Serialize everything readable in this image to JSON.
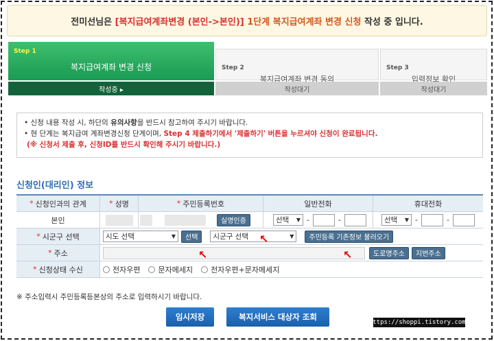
{
  "banner": {
    "name": "전미선님은",
    "highlight": "[복지급여계좌변경 (본인->본인)]",
    "step": "1단계 복지급여계좌 변경 신청",
    "suffix": "작성 중 입니다."
  },
  "steps": [
    {
      "num": "Step 1",
      "title": "복지급여계좌 변경 신청",
      "status": "작성중 ▸"
    },
    {
      "num": "Step 2",
      "title": "복지급여계좌 변경 동의",
      "status": "작성대기"
    },
    {
      "num": "Step 3",
      "title": "입력정보 확인",
      "status": "작성대기"
    }
  ],
  "notice": {
    "line1_a": "• 신청 내용 작성 시, 하단의",
    "line1_b": "유의사항",
    "line1_c": "을 반드시 참고하여 주시기 바랍니다.",
    "line2_a": "• 현 단계는 복지급여 계좌변경신청 단계이며,",
    "line2_b": "Step 4 제출하기에서 '제출하기' 버튼을 누르셔야 신청이 완료됩니다.",
    "line3": "(※ 신청서 제출 후, 신청ID를 반드시 확인해 주시기 바랍니다.)"
  },
  "section_title": "신청인(대리인) 정보",
  "table": {
    "header": {
      "relation": "신청인과의 관계",
      "name": "성명",
      "rrn": "주민등록번호",
      "phone": "일반전화",
      "mobile": "휴대전화"
    },
    "row1": {
      "relation": "본인",
      "verify_btn": "실명인증",
      "phone_select": "선택",
      "mobile_select": "선택"
    },
    "region": {
      "label": "시군구 선택",
      "sido": "시도 선택",
      "select_btn": "선택",
      "sigungu": "시군구 선택",
      "load_btn": "주민등록 기존정보 불러오기"
    },
    "address": {
      "label": "주소",
      "road_btn": "도로명주소",
      "jibun_btn": "지번주소"
    },
    "receive": {
      "label": "신청상태 수신",
      "opt1": "전자우편",
      "opt2": "문자메세지",
      "opt3": "전자우편+문자메세지"
    }
  },
  "footnote": "※ 주소입력시 주민등록등본상의 주소로 입력하시기 바랍니다.",
  "buttons": {
    "save": "임시저장",
    "lookup": "복지서비스 대상자 조회"
  },
  "watermark": "https://shoppi.tistory.com/"
}
